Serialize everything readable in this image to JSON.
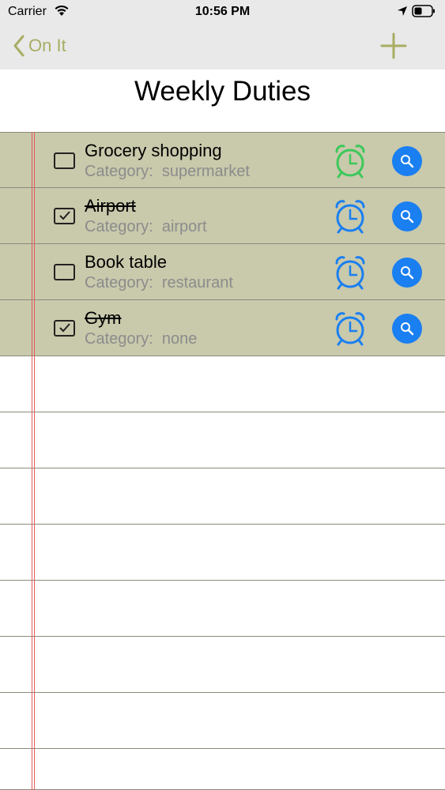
{
  "status_bar": {
    "carrier": "Carrier",
    "time": "10:56 PM"
  },
  "nav": {
    "back_label": "On It",
    "accent_color": "#a8ad63"
  },
  "page": {
    "title": "Weekly Duties"
  },
  "tasks": [
    {
      "title": "Grocery shopping",
      "category": "Category:  supermarket",
      "done": false,
      "alarm_color": "#3cc85a"
    },
    {
      "title": "Airport",
      "category": "Category:  airport",
      "done": true,
      "alarm_color": "#1a7ff0"
    },
    {
      "title": "Book table",
      "category": "Category:  restaurant",
      "done": false,
      "alarm_color": "#1a7ff0"
    },
    {
      "title": "Gym",
      "category": "Category:  none",
      "done": true,
      "alarm_color": "#1a7ff0"
    }
  ],
  "icons": {
    "back": "chevron-left-icon",
    "add": "plus-icon",
    "alarm": "alarm-clock-icon",
    "search": "magnifier-icon"
  }
}
